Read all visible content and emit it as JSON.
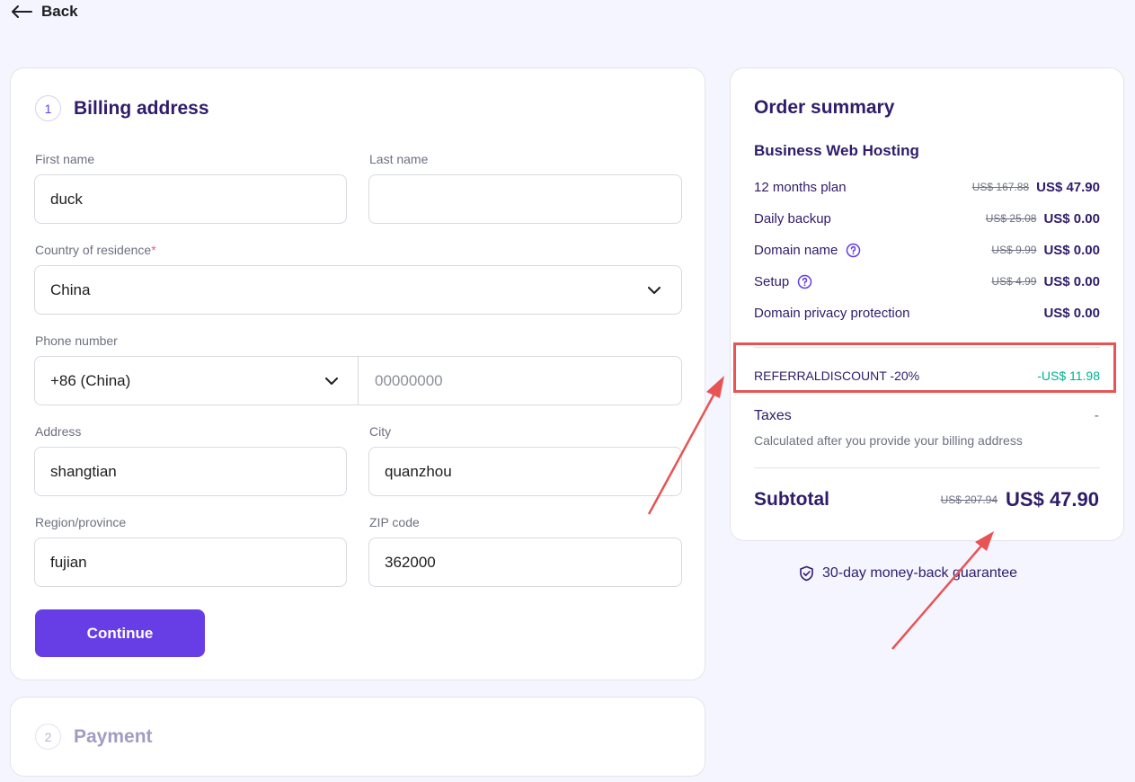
{
  "nav": {
    "back_label": "Back"
  },
  "billing": {
    "step_number": "1",
    "title": "Billing address",
    "first_name": {
      "label": "First name",
      "value": "duck"
    },
    "last_name": {
      "label": "Last name",
      "value": ""
    },
    "country": {
      "label": "Country of residence",
      "required_mark": "*",
      "value": "China"
    },
    "phone": {
      "label": "Phone number",
      "code": "+86 (China)",
      "placeholder": "00000000"
    },
    "address": {
      "label": "Address",
      "value": "shangtian"
    },
    "city": {
      "label": "City",
      "value": "quanzhou"
    },
    "region": {
      "label": "Region/province",
      "value": "fujian"
    },
    "zip": {
      "label": "ZIP code",
      "value": "362000"
    },
    "continue_label": "Continue"
  },
  "payment": {
    "step_number": "2",
    "title": "Payment"
  },
  "summary": {
    "title": "Order summary",
    "product": "Business Web Hosting",
    "items": [
      {
        "name": "12 months plan",
        "old_price": "US$ 167.88",
        "price": "US$ 47.90",
        "help": false
      },
      {
        "name": "Daily backup",
        "old_price": "US$ 25.08",
        "price": "US$ 0.00",
        "help": false
      },
      {
        "name": "Domain name",
        "old_price": "US$ 9.99",
        "price": "US$ 0.00",
        "help": true
      },
      {
        "name": "Setup",
        "old_price": "US$ 4.99",
        "price": "US$ 0.00",
        "help": true
      },
      {
        "name": "Domain privacy protection",
        "old_price": "",
        "price": "US$ 0.00",
        "help": false
      }
    ],
    "discount": {
      "code": "REFERRALDISCOUNT -20%",
      "amount": "-US$ 11.98"
    },
    "taxes": {
      "label": "Taxes",
      "value": "-",
      "note": "Calculated after you provide your billing address"
    },
    "subtotal": {
      "label": "Subtotal",
      "old_price": "US$ 207.94",
      "price": "US$ 47.90"
    }
  },
  "guarantee": "30-day money-back guarantee",
  "colors": {
    "accent": "#673de6",
    "heading": "#2f1c6a",
    "discount": "#00b090",
    "annotation": "#e85454"
  },
  "icons": [
    "arrow-left-icon",
    "chevron-down-icon",
    "help-circle-icon",
    "shield-check-icon"
  ]
}
